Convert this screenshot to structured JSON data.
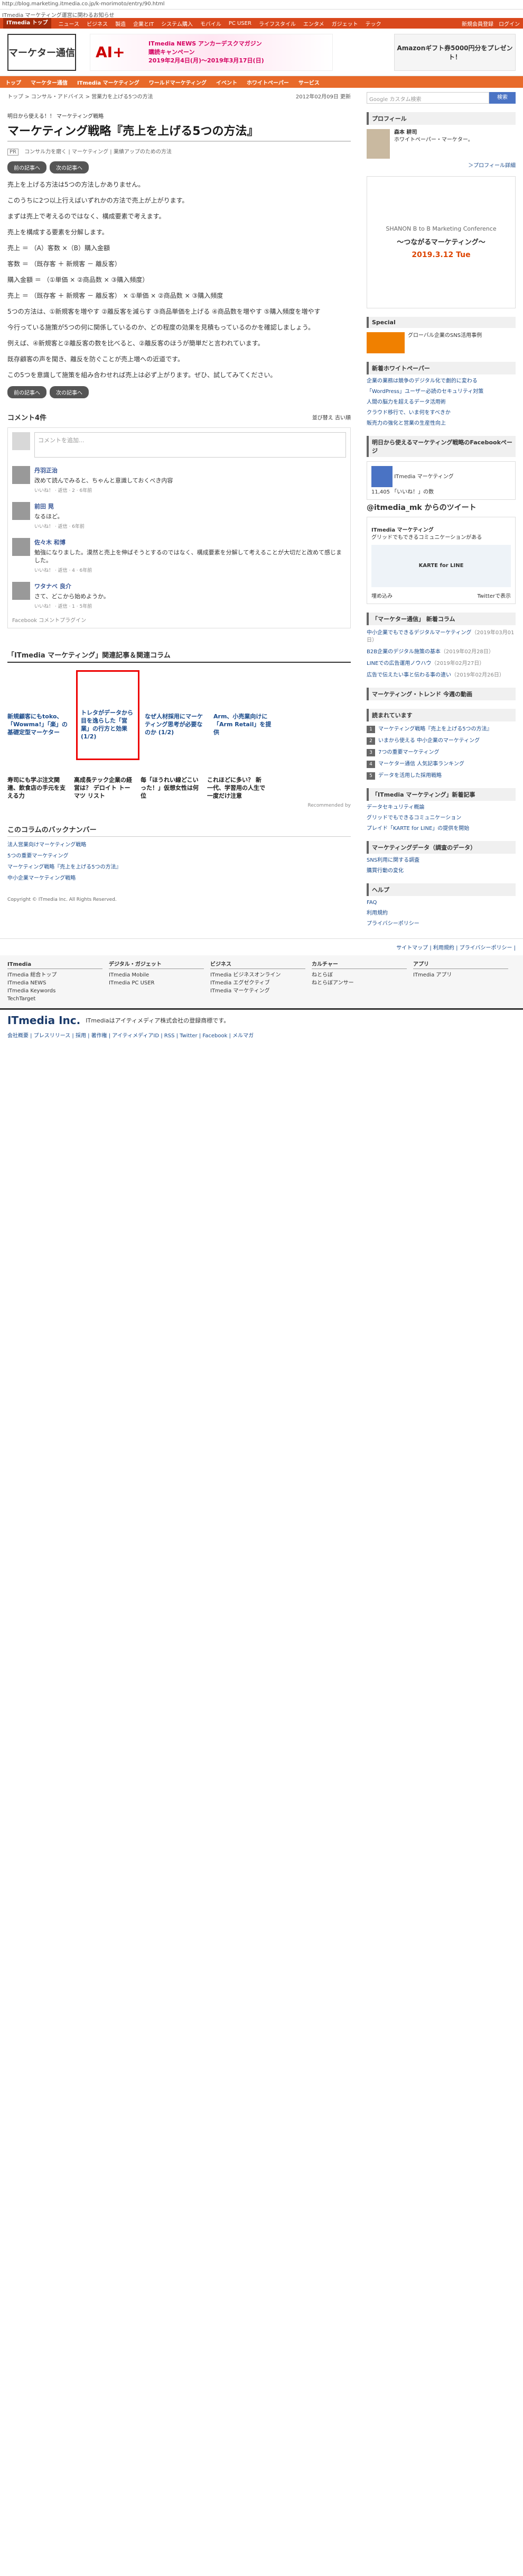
{
  "url": "http://blog.marketing.itmedia.co.jp/k-morimoto/entry/90.html",
  "notice": "ITmedia マーケティング運営に関わるお知らせ",
  "topnav": {
    "items": [
      "ITmedia トップ",
      "ニュース",
      "ビジネス",
      "製造",
      "企業とIT",
      "システム購入",
      "モバイル",
      "PC USER",
      "ライフスタイル",
      "エンタメ",
      "ガジェット",
      "テック"
    ],
    "right": [
      "新規会員登録",
      "ログイン"
    ]
  },
  "header": {
    "logo_text": "マーケター通信",
    "banner_big": "AI+",
    "banner_text_1": "ITmedia NEWS アンカーデスクマガジン",
    "banner_text_2": "購読キャンペーン",
    "banner_text_3": "2019年2月4日(月)～2019年3月17日(日)",
    "amazon_text": "Amazonギフト券5000円分をプレゼント！"
  },
  "catnav": [
    "トップ",
    "マーケター通信",
    "ITmedia マーケティング",
    "ワールドマーケティング",
    "イベント",
    "ホワイトペーパー",
    "サービス"
  ],
  "breadcrumb": "トップ > コンサル・アドバイス > 営業力を上げる5つの方法",
  "date": "2012年02月09日 更新",
  "kicker": "明日から使える！！ マーケティング戦略",
  "title": "マーケティング戦略『売上を上げる5つの方法』",
  "meta": {
    "pr": "PR",
    "tags": "コンサル力を磨く | マーケティング | 業績アップのための方法"
  },
  "navbtns": {
    "prev": "前の記事へ",
    "next": "次の記事へ"
  },
  "body": [
    "売上を上げる方法は5つの方法しかありません。",
    "このうちに2つ以上行えばいずれかの方法で売上が上がります。",
    "まずは売上で考えるのではなく、構成要素で考えます。",
    "売上を構成する要素を分解します。",
    "売上 ＝ （A）客数 ×（B）購入金額",
    "客数 ＝ （既存客 ＋ 新規客 － 離反客）",
    "購入金額 ＝ （①単価 × ②商品数 × ③購入頻度）",
    "売上 ＝ （既存客 ＋ 新規客 － 離反客） × ①単価 × ②商品数 × ③購入頻度",
    "5つの方法は、①新規客を増やす ②離反客を減らす ③商品単価を上げる ④商品数を増やす ⑤購入頻度を増やす",
    "今行っている施策が5つの何に関係しているのか、どの程度の効果を見積もっているのかを確認しましょう。",
    "例えば、④新規客と②離反客の数を比べると、②離反客のほうが簡単だと言われています。",
    "既存顧客の声を聞き、離反を防ぐことが売上増への近道です。",
    "この5つを意識して施策を組み合わせれば売上は必ず上がります。ぜひ、試してみてください。"
  ],
  "comments": {
    "header": "コメント4件",
    "sort": "並び替え",
    "sort_value": "古い順",
    "placeholder": "コメントを追加...",
    "items": [
      {
        "name": "丹羽正治",
        "text": "改めて読んでみると、ちゃんと意識しておくべき内容",
        "actions": "いいね！ · 返信 · 2 · 6年前"
      },
      {
        "name": "前田 晃",
        "text": "なるほど。",
        "actions": "いいね！ · 返信 · 6年前"
      },
      {
        "name": "佐々木 和博",
        "text": "勉強になりました。漠然と売上を伸ばそうとするのではなく、構成要素を分解して考えることが大切だと改めて感じました。",
        "actions": "いいね！ · 返信 · 4 · 6年前"
      },
      {
        "name": "ワタナベ 良介",
        "text": "さて、どこから始めようか。",
        "actions": "いいね！ · 返信 · 1 · 5年前"
      }
    ],
    "plugin": "Facebook コメントプラグイン"
  },
  "related": {
    "header": "「ITmedia マーケティング」関連記事＆関連コラム",
    "cards": [
      "新規顧客にもtoko、「Wowma!」「楽」の基礎定型マーケター",
      "トレタがデータから目を逸らした「営業」の行方と効果 (1/2)",
      "なぜ人材採用にマーケティング思考が必要なのか (1/2)",
      "Arm、小売業向けに「Arm Retail」を提供"
    ],
    "cards2": [
      "寿司にも学ぶ注文関連、飲食店の手元を支える力",
      "高成長テック企業の経営は？ デロイト トーマツ リスト",
      "毎「ほうれい線どこいった！」仮想女性は何位",
      "これほどに多い？ 新一代、学習用の人生で一度だけ注意"
    ],
    "rec": "Recommended by"
  },
  "backnum": {
    "header": "このコラムのバックナンバー",
    "items": [
      "法人営業向けマーケティング戦略",
      "5つの重要マーケティング",
      "マーケティング戦略『売上を上げる5つの方法』",
      "中小企業マーケティング戦略"
    ]
  },
  "copyright": "Copyright © ITmedia Inc. All Rights Reserved.",
  "sidebar": {
    "search_placeholder": "Google カスタム検索",
    "search_button": "検索",
    "profile_h": "プロフィール",
    "profile_name": "森本 耕司",
    "profile_text": "ホワイトペーパー・マーケター。",
    "profile_link": "＞プロフィール詳細",
    "ad1": "SHANON B to B Marketing Conference",
    "ad2": "～つながるマーケティング～",
    "ad3": "2019.3.12 Tue",
    "special_h": "Special",
    "special_text": "グローバル企業のSNS活用事例",
    "wp_h": "新着ホワイトペーパー",
    "wp_items": [
      "企業の業務は競争のデジタル化で劇的に変わる",
      "「WordPress」ユーザー必読のセキュリティ対策",
      "人間の脳力を超えるデータ活用術",
      "クラウド移行で、いま何をすべきか",
      "販売力の強化と営業の生産性向上"
    ],
    "fb_h": "明日から使えるマーケティング戦略のFacebookページ",
    "fb_page": "ITmedia マーケティング",
    "fb_likes": "11,405 「いいね！」の数",
    "tw_h": "@itmedia_mk からのツイート",
    "tw_name": "ITmedia マーケティング",
    "tw_text": "グリッドでもできるコミュニケーションがある",
    "tw_card": "KARTE for LINE",
    "tw_embed": "埋め込み",
    "tw_view": "Twitterで表示",
    "marker_h": "「マーケター通信」 新着コラム",
    "marker_items": [
      {
        "t": "中小企業でもできるデジタルマーケティング",
        "d": "（2019年03月01日）"
      },
      {
        "t": "B2B企業のデジタル施策の基本",
        "d": "（2019年02月28日）"
      },
      {
        "t": "LINEでの広告運用ノウハウ",
        "d": "（2019年02月27日）"
      },
      {
        "t": "広告で伝えたい事と伝わる事の違い",
        "d": "（2019年02月26日）"
      }
    ],
    "rank_h": "マーケティング・トレンド 今週の動画",
    "rank_h2": "読まれています",
    "rank_items": [
      "マーケティング戦略『売上を上げる5つの方法』",
      "いまから使える 中小企業のマーケティング",
      "7つの重要マーケティング",
      "マーケター通信 人気記事ランキング",
      "データを活用した採用戦略"
    ],
    "itm_h": "「ITmedia マーケティング」新着記事",
    "itm_items": [
      "データセキュリティ概論",
      "グリッドでもできるコミュニケーション",
      "プレイド「KARTE for LINE」の提供を開始"
    ],
    "kind_h": "マーケティングデータ（調査のデータ）",
    "kind_items": [
      "SNS利用に関する調査",
      "購買行動の変化"
    ],
    "help_h": "ヘルプ",
    "help_items": [
      "FAQ",
      "利用規約",
      "プライバシーポリシー"
    ]
  },
  "footer": {
    "nav": "サイトマップ | 利用規約 | プライバシーポリシー | ",
    "cols": [
      {
        "h": "ITmedia",
        "items": [
          "ITmedia 総合トップ",
          "ITmedia NEWS",
          "ITmedia Keywords",
          "TechTarget"
        ]
      },
      {
        "h": "デジタル・ガジェット",
        "items": [
          "ITmedia Mobile",
          "ITmedia PC USER"
        ]
      },
      {
        "h": "ビジネス",
        "items": [
          "ITmedia ビジネスオンライン",
          "ITmedia エグゼクティブ",
          "ITmedia マーケティング"
        ]
      },
      {
        "h": "カルチャー",
        "items": [
          "ねとらぼ",
          "ねとらぼアンサー"
        ]
      },
      {
        "h": "アプリ",
        "items": [
          "ITmedia アプリ"
        ]
      }
    ],
    "brand": "ITmedia Inc.",
    "brand_text": "ITmediaはアイティメディア株式会社の登録商標です。",
    "links": "会社概要 | プレスリリース | 採用 | 著作権 | アイティメディアID | RSS | Twitter | Facebook | メルマガ"
  }
}
